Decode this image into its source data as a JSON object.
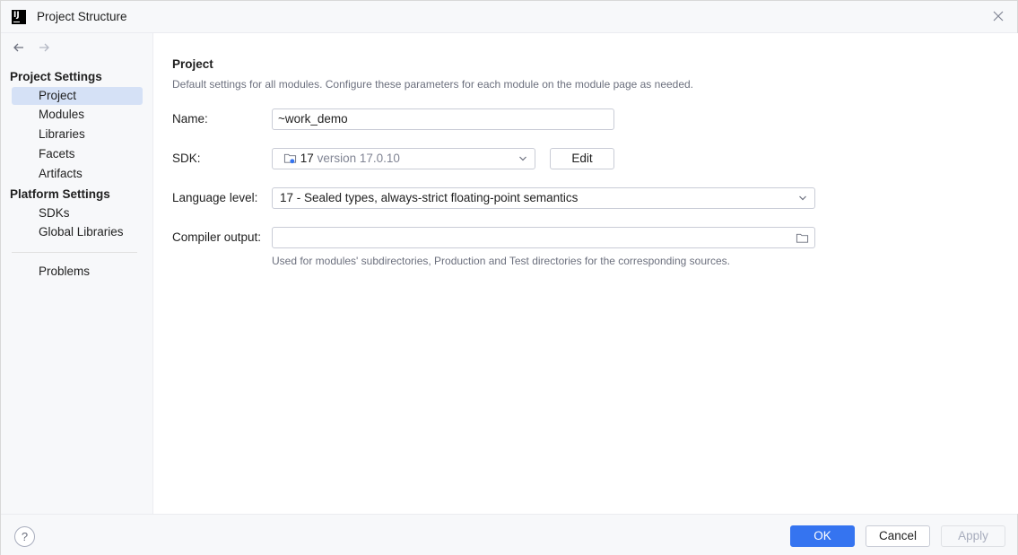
{
  "window": {
    "title": "Project Structure",
    "app_icon_text": "IJ"
  },
  "sidebar": {
    "project_settings_header": "Project Settings",
    "project_items": [
      {
        "label": "Project",
        "selected": true
      },
      {
        "label": "Modules"
      },
      {
        "label": "Libraries"
      },
      {
        "label": "Facets"
      },
      {
        "label": "Artifacts"
      }
    ],
    "platform_settings_header": "Platform Settings",
    "platform_items": [
      {
        "label": "SDKs"
      },
      {
        "label": "Global Libraries"
      }
    ],
    "problems_label": "Problems"
  },
  "content": {
    "title": "Project",
    "description": "Default settings for all modules. Configure these parameters for each module on the module page as needed.",
    "name_label": "Name:",
    "name_value": "~work_demo",
    "sdk_label": "SDK:",
    "sdk_name": "17",
    "sdk_version": "version 17.0.10",
    "edit_label": "Edit",
    "language_level_label": "Language level:",
    "language_level_value": "17 - Sealed types, always-strict floating-point semantics",
    "compiler_output_label": "Compiler output:",
    "compiler_output_value": "",
    "compiler_output_hint": "Used for modules' subdirectories, Production and Test directories for the corresponding sources."
  },
  "footer": {
    "help_label": "?",
    "ok_label": "OK",
    "cancel_label": "Cancel",
    "apply_label": "Apply"
  },
  "colors": {
    "accent": "#3574f0",
    "selection": "#d5e1f6",
    "panel_bg": "#f7f8fa",
    "muted_text": "#6c707e"
  },
  "icons": [
    "back-arrow-icon",
    "forward-arrow-icon",
    "close-icon",
    "folder-icon",
    "sdk-folder-icon",
    "chevron-down-icon",
    "help-icon"
  ]
}
